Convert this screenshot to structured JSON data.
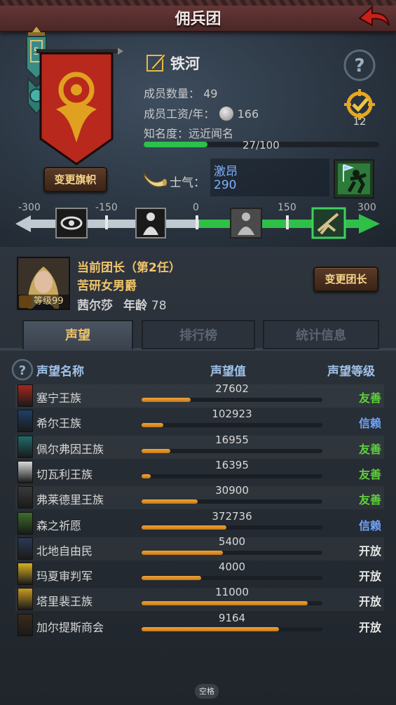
{
  "header": {
    "title": "佣兵团"
  },
  "company": {
    "name": "铁河",
    "stats": {
      "members_label": "成员数量：",
      "members_value": "49",
      "wage_label": "成员工资/年：",
      "wage_value": "166",
      "fame_label": "知名度：",
      "fame_value": "远近闻名",
      "fame_progress_text": "27/100",
      "fame_progress": 0.27
    },
    "fame_level": "12",
    "change_banner_label": "变更旗帜",
    "morale": {
      "label": "士气：",
      "word": "激昂",
      "value": "290"
    }
  },
  "morale_scale": {
    "ticks": [
      "-300",
      "-150",
      "0",
      "150",
      "300"
    ],
    "current": 290,
    "min": -300,
    "max": 300
  },
  "captain": {
    "title": "当前团长（第2任）",
    "trait": "苦研女男爵",
    "name": "茜尔莎",
    "age_label": "年龄",
    "age": "78",
    "level_text": "等级99",
    "change_label": "变更团长"
  },
  "tabs": [
    {
      "label": "声望"
    },
    {
      "label": "排行榜"
    },
    {
      "label": "统计信息"
    }
  ],
  "table": {
    "headers": {
      "name": "声望名称",
      "value": "声望值",
      "level": "声望等级"
    },
    "rows": [
      {
        "name": "塞宁王族",
        "value": "27602",
        "progress": 0.27,
        "level": "友善",
        "level_color": "#5fcf3c",
        "icon_color": "#a4281e"
      },
      {
        "name": "希尔王族",
        "value": "102923",
        "progress": 0.12,
        "level": "信赖",
        "level_color": "#6fa4ff",
        "icon_color": "#1f3f66"
      },
      {
        "name": "佩尔弗因王族",
        "value": "16955",
        "progress": 0.16,
        "level": "友善",
        "level_color": "#5fcf3c",
        "icon_color": "#1f6b6b"
      },
      {
        "name": "切瓦利王族",
        "value": "16395",
        "progress": 0.05,
        "level": "友善",
        "level_color": "#5fcf3c",
        "icon_color": "#d8d8d8"
      },
      {
        "name": "弗莱德里王族",
        "value": "30900",
        "progress": 0.31,
        "level": "友善",
        "level_color": "#5fcf3c",
        "icon_color": "#3a3a3a"
      },
      {
        "name": "森之祈愿",
        "value": "372736",
        "progress": 0.47,
        "level": "信赖",
        "level_color": "#6fa4ff",
        "icon_color": "#3c6f2a"
      },
      {
        "name": "北地自由民",
        "value": "5400",
        "progress": 0.45,
        "level": "开放",
        "level_color": "#e6e6e6",
        "icon_color": "#2c3a55"
      },
      {
        "name": "玛夏审判军",
        "value": "4000",
        "progress": 0.33,
        "level": "开放",
        "level_color": "#e6e6e6",
        "icon_color": "#d8b020"
      },
      {
        "name": "塔里裴王族",
        "value": "11000",
        "progress": 0.92,
        "level": "开放",
        "level_color": "#e6e6e6",
        "icon_color": "#c99a20"
      },
      {
        "name": "加尔提斯商会",
        "value": "9164",
        "progress": 0.76,
        "level": "开放",
        "level_color": "#e6e6e6",
        "icon_color": "#3a2a1a"
      }
    ]
  },
  "footer": {
    "hint": "空格"
  },
  "colors": {
    "accent_gold": "#f0c46b",
    "morale_blue": "#7fb0ff",
    "bar_orange": "#e8962a",
    "fame_green": "#2cc04c"
  }
}
